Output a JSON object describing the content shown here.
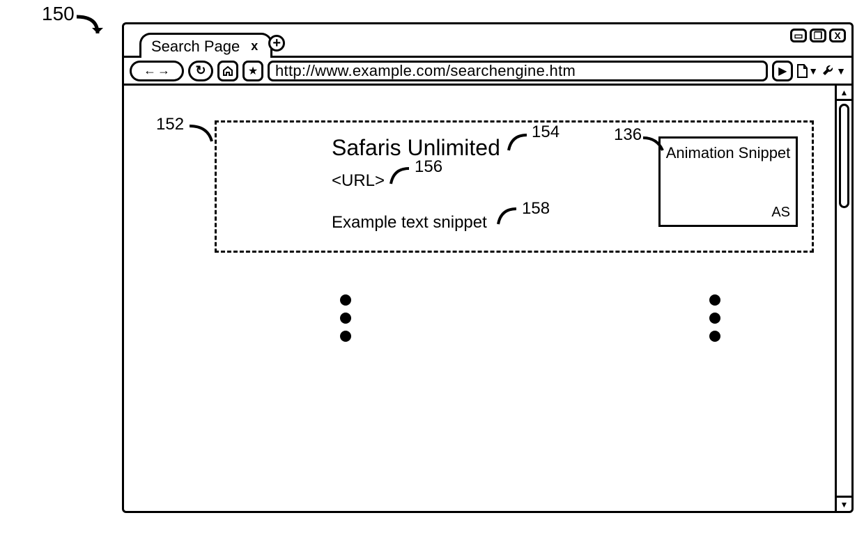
{
  "figure": {
    "main_ref": "150",
    "refs": {
      "result_box": "152",
      "title": "154",
      "url": "156",
      "snippet": "158",
      "animation": "136"
    }
  },
  "browser": {
    "tab_title": "Search Page",
    "tab_close": "x",
    "new_tab": "+",
    "url": "http://www.example.com/searchengine.htm",
    "window_controls": {
      "min": "▭",
      "max": "❐",
      "close": "X"
    },
    "nav": {
      "back": "←",
      "forward": "→",
      "reload": "↻"
    }
  },
  "result": {
    "title": "Safaris Unlimited",
    "url_placeholder": "<URL>",
    "text_snippet": "Example text snippet"
  },
  "animation": {
    "label": "Animation Snippet",
    "code": "AS"
  }
}
